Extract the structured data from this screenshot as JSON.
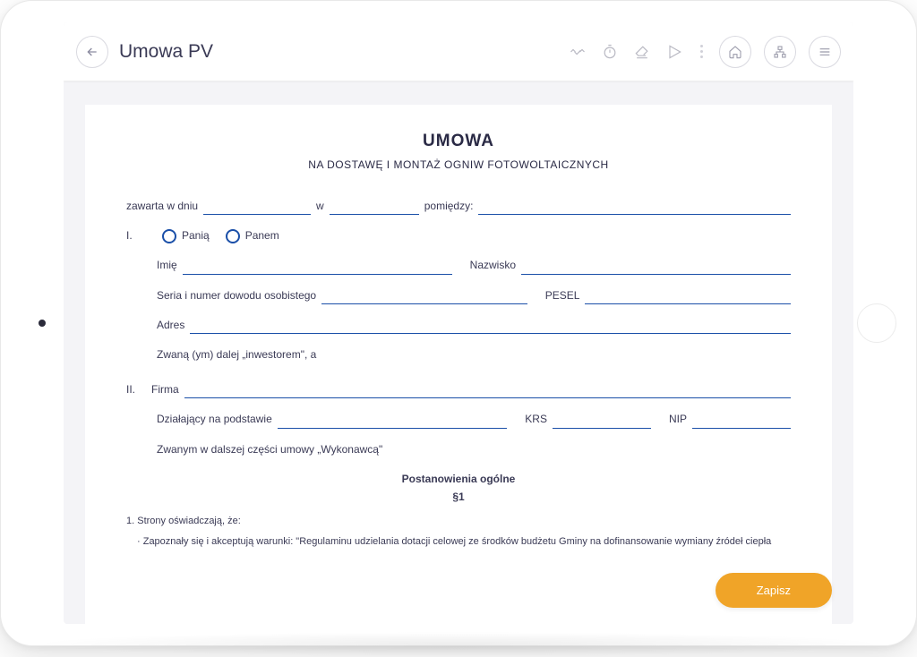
{
  "header": {
    "title": "Umowa PV"
  },
  "save_button": "Zapisz",
  "doc": {
    "title": "UMOWA",
    "subtitle": "NA DOSTAWĘ I MONTAŻ OGNIW FOTOWOLTAICZNYCH",
    "line1": {
      "t1": "zawarta w dniu",
      "t2": "w",
      "t3": "pomiędzy:"
    },
    "party1": {
      "roman": "I.",
      "gender_f": "Panią",
      "gender_m": "Panem",
      "name_lbl": "Imię",
      "surname_lbl": "Nazwisko",
      "id_lbl": "Seria i numer dowodu osobistego",
      "pesel_lbl": "PESEL",
      "address_lbl": "Adres",
      "suffix": "Zwaną (ym) dalej „inwestorem\", a"
    },
    "party2": {
      "roman": "II.",
      "company_lbl": "Firma",
      "basis_lbl": "Działający na podstawie",
      "krs_lbl": "KRS",
      "nip_lbl": "NIP",
      "suffix": "Zwanym w dalszej części umowy „Wykonawcą\""
    },
    "section_title": "Postanowienia ogólne",
    "paragraph_sym": "§1",
    "body_1": "1. Strony oświadczają, że:",
    "body_2": "· Zapoznały się i akceptują warunki: \"Regulaminu udzielania dotacji celowej ze środków budżetu Gminy na dofinansowanie wymiany źródeł ciepła"
  }
}
